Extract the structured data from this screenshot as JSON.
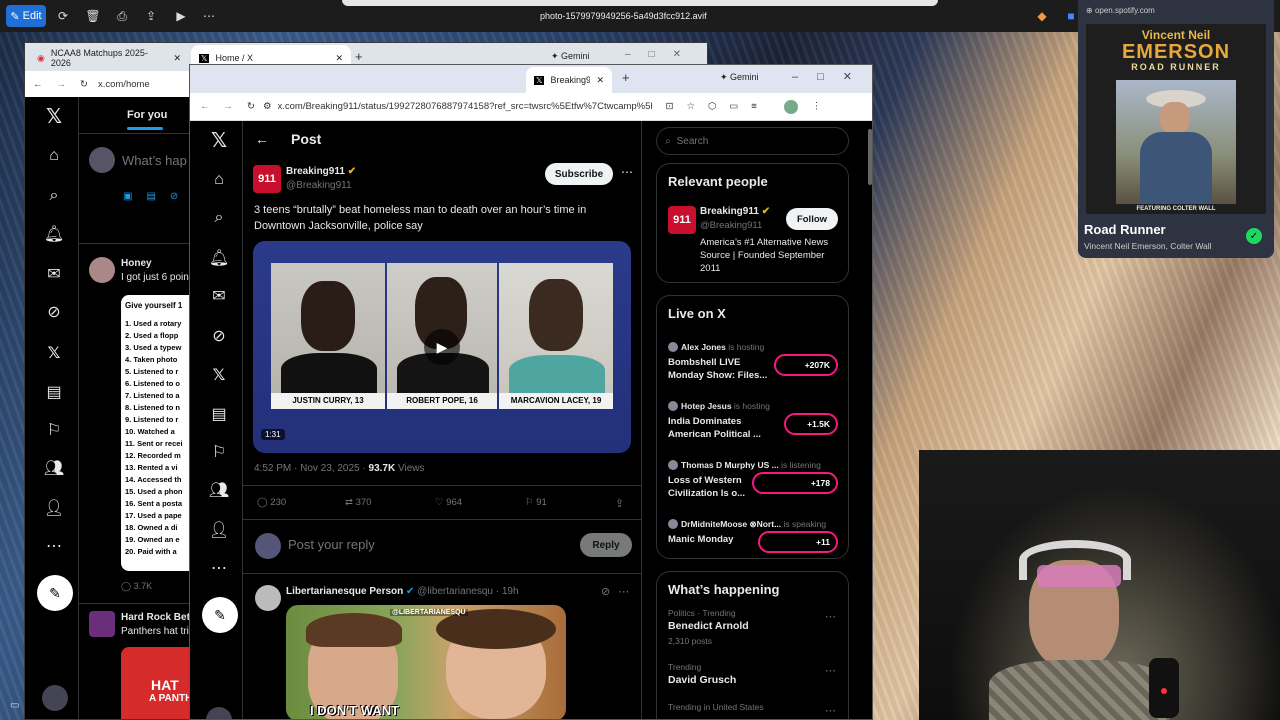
{
  "viewer": {
    "edit_label": "Edit",
    "file_name": "photo-1579979949256-5a49d3fcc912.avif"
  },
  "back_window": {
    "tabs": [
      {
        "label": "NCAA8 Matchups 2025-2026"
      },
      {
        "label": "Home / X"
      }
    ],
    "gemini_label": "Gemini",
    "url": "x.com/home",
    "for_you": "For you",
    "compose_placeholder": "What’s hap",
    "post1": {
      "name": "Honey",
      "text": "I got just 6 poin",
      "list_title": "Give yourself 1",
      "list": [
        "1. Used a rotary",
        "2. Used a flopp",
        "3. Used a typew",
        "4. Taken photo",
        "5. Listened to r",
        "6. Listened to o",
        "7. Listened to a",
        "8. Listened to n",
        "9. Listened to r",
        "10. Watched a",
        "11. Sent or recei",
        "12. Recorded m",
        "13. Rented a vi",
        "14. Accessed th",
        "15. Used a phon",
        "16. Sent a posta",
        "17. Used a pape",
        "18. Owned a di",
        "19. Owned an e",
        "20. Paid with a"
      ],
      "views": "3.7K"
    },
    "post2": {
      "name": "Hard Rock Bet",
      "text": "Panthers hat tri",
      "promo": "HAT",
      "promo2": "A PANTH"
    }
  },
  "front_window": {
    "tab_label": "Breaking911",
    "gemini_label": "Gemini",
    "url": "x.com/Breaking911/status/1992728076887974158?ref_src=twsrc%5Etfw%7Ctwcamp%5Et...",
    "header": "Post",
    "tweet": {
      "name": "Breaking911",
      "handle": "@Breaking911",
      "subscribe": "Subscribe",
      "text": "3 teens “brutally” beat homeless man to death over an hour’s time in Downtown Jacksonville, police say",
      "mugshots": [
        "JUSTIN CURRY, 13",
        "ROBERT POPE, 16",
        "MARCAVION LACEY, 19"
      ],
      "duration": "1:31",
      "time": "4:52 PM · Nov 23, 2025 · ",
      "views": "93.7K",
      "views_label": " Views",
      "replies": "230",
      "reposts": "370",
      "likes": "964",
      "bookmarks": "91"
    },
    "reply_placeholder": "Post your reply",
    "reply_button": "Reply",
    "reply1": {
      "name": "Libertarianesque Person",
      "handle": "@libertarianesqu · 19h",
      "meme_tag": "@LIBERTARIANESQU",
      "meme_caption": "I DON'T WANT"
    },
    "search_placeholder": "Search",
    "relevant": {
      "title": "Relevant people",
      "name": "Breaking911",
      "handle": "@Breaking911",
      "follow": "Follow",
      "bio": "America’s #1 Alternative News Source | Founded September 2011"
    },
    "live": {
      "title": "Live on X",
      "items": [
        {
          "host": "Alex Jones",
          "status": "is hosting",
          "title": "Bombshell LIVE Monday Show: Files...",
          "count": "+207K"
        },
        {
          "host": "Hotep Jesus",
          "status": "is hosting",
          "title": "India Dominates American Political ...",
          "count": "+1.5K"
        },
        {
          "host": "Thomas D Murphy US ...",
          "status": "is listening",
          "title": "Loss of Western Civilization Is o...",
          "count": "+178"
        },
        {
          "host": "DrMidniteMoose ⊗Nort...",
          "status": "is speaking",
          "title": "Manic Monday",
          "count": "+11"
        }
      ]
    },
    "happening": {
      "title": "What’s happening",
      "items": [
        {
          "context": "Politics · Trending",
          "topic": "Benedict Arnold",
          "posts": "2,310 posts"
        },
        {
          "context": "Trending",
          "topic": "David Grusch",
          "posts": ""
        },
        {
          "context": "Trending in United States",
          "topic": "",
          "posts": ""
        }
      ]
    }
  },
  "spotify": {
    "url": "open.spotify.com",
    "artist_line": "Vincent Neil",
    "artist_big": "EMERSON",
    "album": "ROAD RUNNER",
    "featuring": "FEATURING COLTER WALL",
    "song": "Road Runner",
    "artists": "Vincent Neil Emerson, Colter Wall"
  },
  "colors": {
    "x_blue": "#1d9bf0",
    "live_pink": "#f91880",
    "spotify_green": "#1ed760"
  }
}
